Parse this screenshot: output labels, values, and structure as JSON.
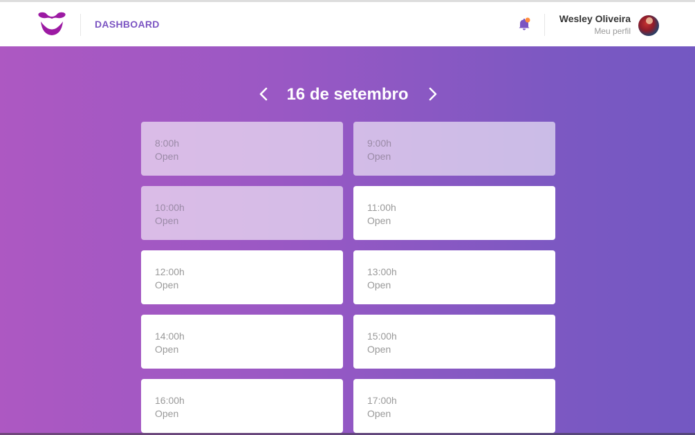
{
  "header": {
    "nav_label": "DASHBOARD",
    "user": {
      "name": "Wesley Oliveira",
      "profile_link": "Meu perfil"
    },
    "notification_dot_color": "#ff8b3d",
    "accent_color": "#7b54c2",
    "logo_color": "#9c1aa3"
  },
  "schedule": {
    "date_label": "16 de setembro",
    "slots": [
      {
        "time": "8:00h",
        "status": "Open",
        "past": true
      },
      {
        "time": "9:00h",
        "status": "Open",
        "past": true
      },
      {
        "time": "10:00h",
        "status": "Open",
        "past": true
      },
      {
        "time": "11:00h",
        "status": "Open",
        "past": false
      },
      {
        "time": "12:00h",
        "status": "Open",
        "past": false
      },
      {
        "time": "13:00h",
        "status": "Open",
        "past": false
      },
      {
        "time": "14:00h",
        "status": "Open",
        "past": false
      },
      {
        "time": "15:00h",
        "status": "Open",
        "past": false
      },
      {
        "time": "16:00h",
        "status": "Open",
        "past": false
      },
      {
        "time": "17:00h",
        "status": "Open",
        "past": false
      }
    ]
  },
  "background_gradient": [
    "#ad58c2",
    "#7358c2"
  ]
}
